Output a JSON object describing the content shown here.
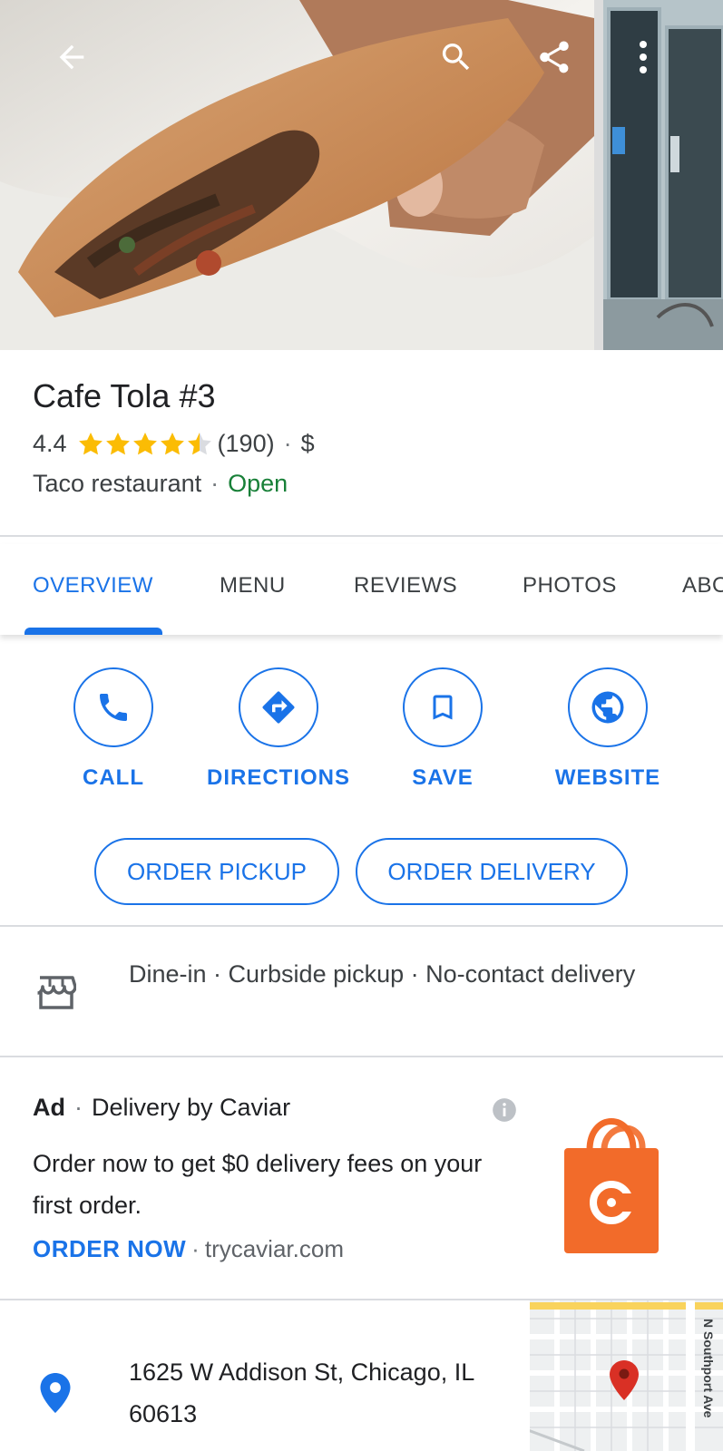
{
  "place": {
    "name": "Cafe Tola #3",
    "rating": "4.4",
    "rating_stars": 4.4,
    "review_count": "(190)",
    "price": "$",
    "category": "Taco restaurant",
    "status": "Open",
    "separator": "·"
  },
  "tabs": [
    {
      "label": "OVERVIEW",
      "active": true
    },
    {
      "label": "MENU"
    },
    {
      "label": "REVIEWS"
    },
    {
      "label": "PHOTOS"
    },
    {
      "label": "ABO"
    }
  ],
  "actions": [
    {
      "label": "CALL",
      "icon": "phone-icon"
    },
    {
      "label": "DIRECTIONS",
      "icon": "directions-icon"
    },
    {
      "label": "SAVE",
      "icon": "bookmark-icon"
    },
    {
      "label": "WEBSITE",
      "icon": "globe-icon"
    }
  ],
  "order": {
    "pickup": "ORDER PICKUP",
    "delivery": "ORDER DELIVERY"
  },
  "services": {
    "icon": "storefront-icon",
    "text": "Dine-in · Curbside pickup · No-contact delivery"
  },
  "ad": {
    "tag": "Ad",
    "title": "Delivery by Caviar",
    "body": "Order now to get $0 delivery fees on your first order.",
    "cta": "ORDER NOW",
    "domain": "trycaviar.com",
    "logo_letter": "C"
  },
  "address": {
    "line": "1625 W Addison St, Chicago, IL 60613",
    "map_street": "N Southport Ave"
  },
  "colors": {
    "accent": "#1a73e8",
    "open": "#188038",
    "star": "#fbbc04",
    "caviar": "#f26b2a",
    "pin": "#d93025"
  }
}
